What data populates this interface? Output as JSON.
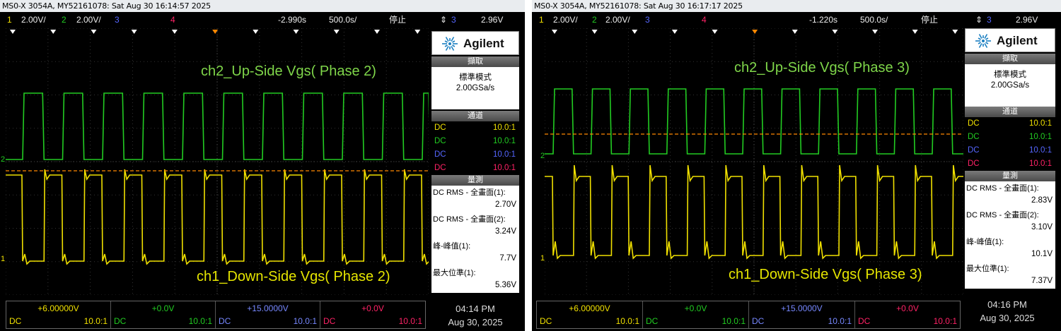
{
  "colors": {
    "ch1": "#f0e000",
    "ch2": "#22cc22",
    "ch3": "#5566ff",
    "ch4": "#ff2266",
    "trigger": "#ff8800"
  },
  "scopes": [
    {
      "title": "MS0-X 3054A, MY52161078: Sat Aug 30 16:14:57 2025",
      "status": {
        "ch1_num": "1",
        "ch1_scale": "2.00V/",
        "ch2_num": "2",
        "ch2_scale": "2.00V/",
        "ch3_num": "3",
        "ch4_num": "4",
        "delay": "-2.990s",
        "timebase": "500.0s/",
        "state": "停止",
        "trig_icon": "⇕",
        "trig_src": "3",
        "trig_level": "2.96V"
      },
      "annotations": {
        "ch2": "ch2_Up-Side Vgs( Phase 2)",
        "ch1": "ch1_Down-Side Vgs( Phase 2)"
      },
      "panel": {
        "brand": "Agilent",
        "acq_header": "擷取",
        "acq_mode": "標準模式",
        "acq_rate": "2.00GSa/s",
        "chan_header": "通道",
        "channels": [
          {
            "c": "DC",
            "p": "10.0:1"
          },
          {
            "c": "DC",
            "p": "10.0:1"
          },
          {
            "c": "DC",
            "p": "10.0:1"
          },
          {
            "c": "DC",
            "p": "10.0:1"
          }
        ],
        "meas_header": "量測",
        "meas": [
          {
            "label": "DC RMS - 全畫面(1):",
            "value": "2.70V"
          },
          {
            "label": "DC RMS - 全畫面(2):",
            "value": "3.24V"
          },
          {
            "label": "峰-峰值(1):",
            "value": "7.7V"
          },
          {
            "label": "最大位準(1):",
            "value": "5.36V"
          }
        ]
      },
      "bottom": [
        {
          "offset": "+6.00000V",
          "coupling": "DC",
          "probe": "10.0:1"
        },
        {
          "offset": "+0.0V",
          "coupling": "DC",
          "probe": "10.0:1"
        },
        {
          "offset": "+15.0000V",
          "coupling": "DC",
          "probe": "10.0:1"
        },
        {
          "offset": "+0.0V",
          "coupling": "DC",
          "probe": "10.0:1"
        }
      ],
      "clock": {
        "time": "04:14 PM",
        "date": "Aug 30, 2025"
      },
      "markers": {
        "ch2": "2",
        "ch1": "1"
      }
    },
    {
      "title": "MS0-X 3054A, MY52161078: Sat Aug 30 16:17:17 2025",
      "status": {
        "ch1_num": "1",
        "ch1_scale": "2.00V/",
        "ch2_num": "2",
        "ch2_scale": "2.00V/",
        "ch3_num": "3",
        "ch4_num": "4",
        "delay": "-1.220s",
        "timebase": "500.0s/",
        "state": "停止",
        "trig_icon": "⇕",
        "trig_src": "3",
        "trig_level": "2.96V"
      },
      "annotations": {
        "ch2": "ch2_Up-Side Vgs( Phase 3)",
        "ch1": "ch1_Down-Side Vgs( Phase 3)"
      },
      "panel": {
        "brand": "Agilent",
        "acq_header": "擷取",
        "acq_mode": "標準模式",
        "acq_rate": "2.00GSa/s",
        "chan_header": "通道",
        "channels": [
          {
            "c": "DC",
            "p": "10.0:1"
          },
          {
            "c": "DC",
            "p": "10.0:1"
          },
          {
            "c": "DC",
            "p": "10.0:1"
          },
          {
            "c": "DC",
            "p": "10.0:1"
          }
        ],
        "meas_header": "量測",
        "meas": [
          {
            "label": "DC RMS - 全畫面(1):",
            "value": "2.83V"
          },
          {
            "label": "DC RMS - 全畫面(2):",
            "value": "3.10V"
          },
          {
            "label": "峰-峰值(1):",
            "value": "10.1V"
          },
          {
            "label": "最大位準(1):",
            "value": "7.37V"
          }
        ]
      },
      "bottom": [
        {
          "offset": "+6.00000V",
          "coupling": "DC",
          "probe": "10.0:1"
        },
        {
          "offset": "+0.0V",
          "coupling": "DC",
          "probe": "10.0:1"
        },
        {
          "offset": "+15.0000V",
          "coupling": "DC",
          "probe": "10.0:1"
        },
        {
          "offset": "+0.0V",
          "coupling": "DC",
          "probe": "10.0:1"
        }
      ],
      "clock": {
        "time": "04:16 PM",
        "date": "Aug 30, 2025"
      },
      "markers": {
        "ch2": "2",
        "ch1": "1"
      }
    }
  ]
}
